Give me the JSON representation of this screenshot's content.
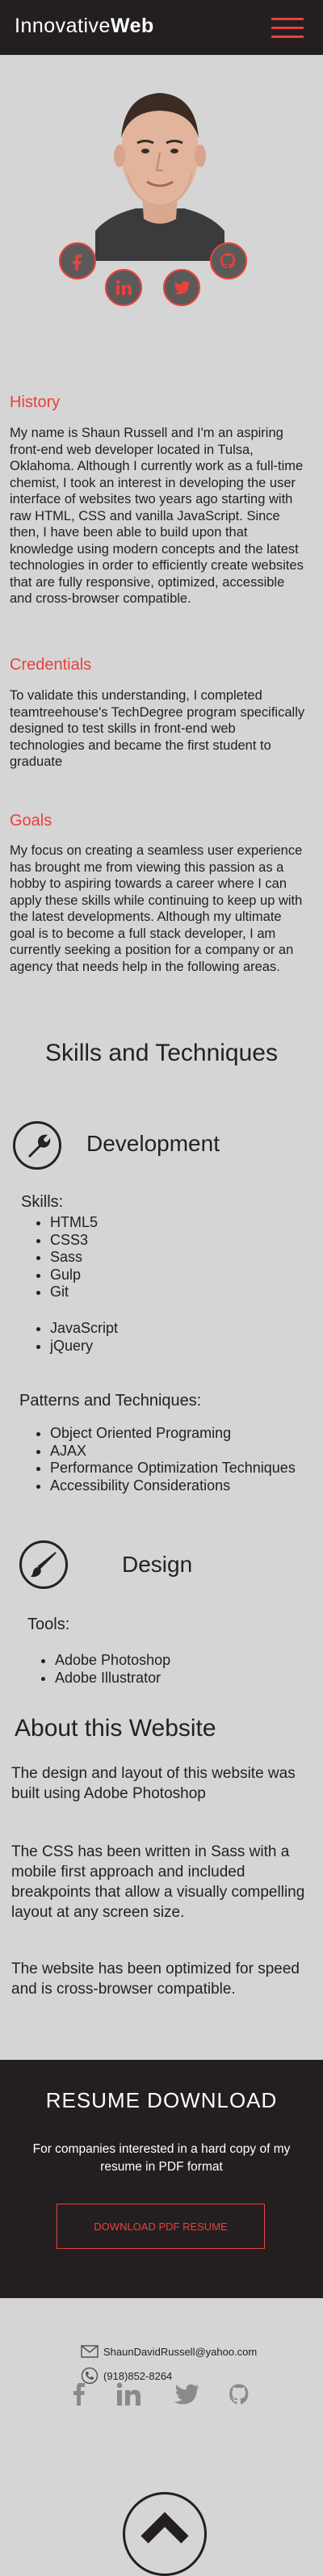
{
  "header": {
    "logo_light": "Innovative",
    "logo_bold": "Web"
  },
  "colors": {
    "accent": "#e9413b",
    "dark": "#231f20",
    "background": "#d5d5d5"
  },
  "hero": {
    "social_icons": [
      "facebook-icon",
      "linkedin-icon",
      "twitter-icon",
      "github-icon"
    ]
  },
  "history": {
    "title": "History",
    "text": "My name is Shaun Russell and I'm an aspiring front-end web developer located in Tulsa, Oklahoma. Although I currently work as a full-time chemist, I took an interest in developing the user interface of websites two years ago starting with raw HTML, CSS and vanilla JavaScript.  Since then, I have been able to build upon that knowledge using modern concepts and the latest technologies in order to efficiently create websites that are fully responsive, optimized, accessible and cross-browser compatible."
  },
  "credentials": {
    "title": "Credentials",
    "text": "To validate this understanding, I completed teamtreehouse's TechDegree program specifically designed to test skills in front-end web technologies and became the first student to graduate"
  },
  "goals": {
    "title": "Goals",
    "text": "My focus on creating a seamless user experience has brought me from viewing this passion as a hobby to aspiring towards a career where I can apply these skills while continuing to keep up with the latest developments. Although my ultimate goal is to become a full stack developer, I am currently seeking a position for a company or an agency that needs help in the following areas."
  },
  "skills": {
    "heading": "Skills and Techniques",
    "development": {
      "title": "Development",
      "skills_label": "Skills:",
      "skills_a": [
        "HTML5",
        "CSS3",
        "Sass",
        "Gulp",
        "Git"
      ],
      "skills_b": [
        "JavaScript",
        "jQuery"
      ],
      "patterns_label": "Patterns and Techniques:",
      "patterns": [
        "Object Oriented Programing",
        "AJAX",
        "Performance Optimization Techniques",
        "Accessibility Considerations"
      ]
    },
    "design": {
      "title": "Design",
      "tools_label": "Tools:",
      "tools": [
        "Adobe Photoshop",
        "Adobe Illustrator"
      ]
    }
  },
  "about": {
    "title": "About this Website",
    "p1": "The design and layout of this website was built using Adobe Photoshop",
    "p2": "The CSS has been written in Sass with a mobile first approach and included breakpoints that allow a visually compelling layout at any screen size.",
    "p3": "The website has been optimized for speed and is cross-browser compatible."
  },
  "resume": {
    "title": "RESUME DOWNLOAD",
    "subtitle": "For companies interested in a hard copy of my resume in PDF format",
    "button": "DOWNLOAD PDF RESUME"
  },
  "contact": {
    "email": "ShaunDavidRussell@yahoo.com",
    "phone": "(918)852-8264",
    "footer_icons": [
      "facebook-icon",
      "linkedin-icon",
      "twitter-icon",
      "github-icon"
    ],
    "back_to_top_icon": "chevron-up-icon"
  }
}
